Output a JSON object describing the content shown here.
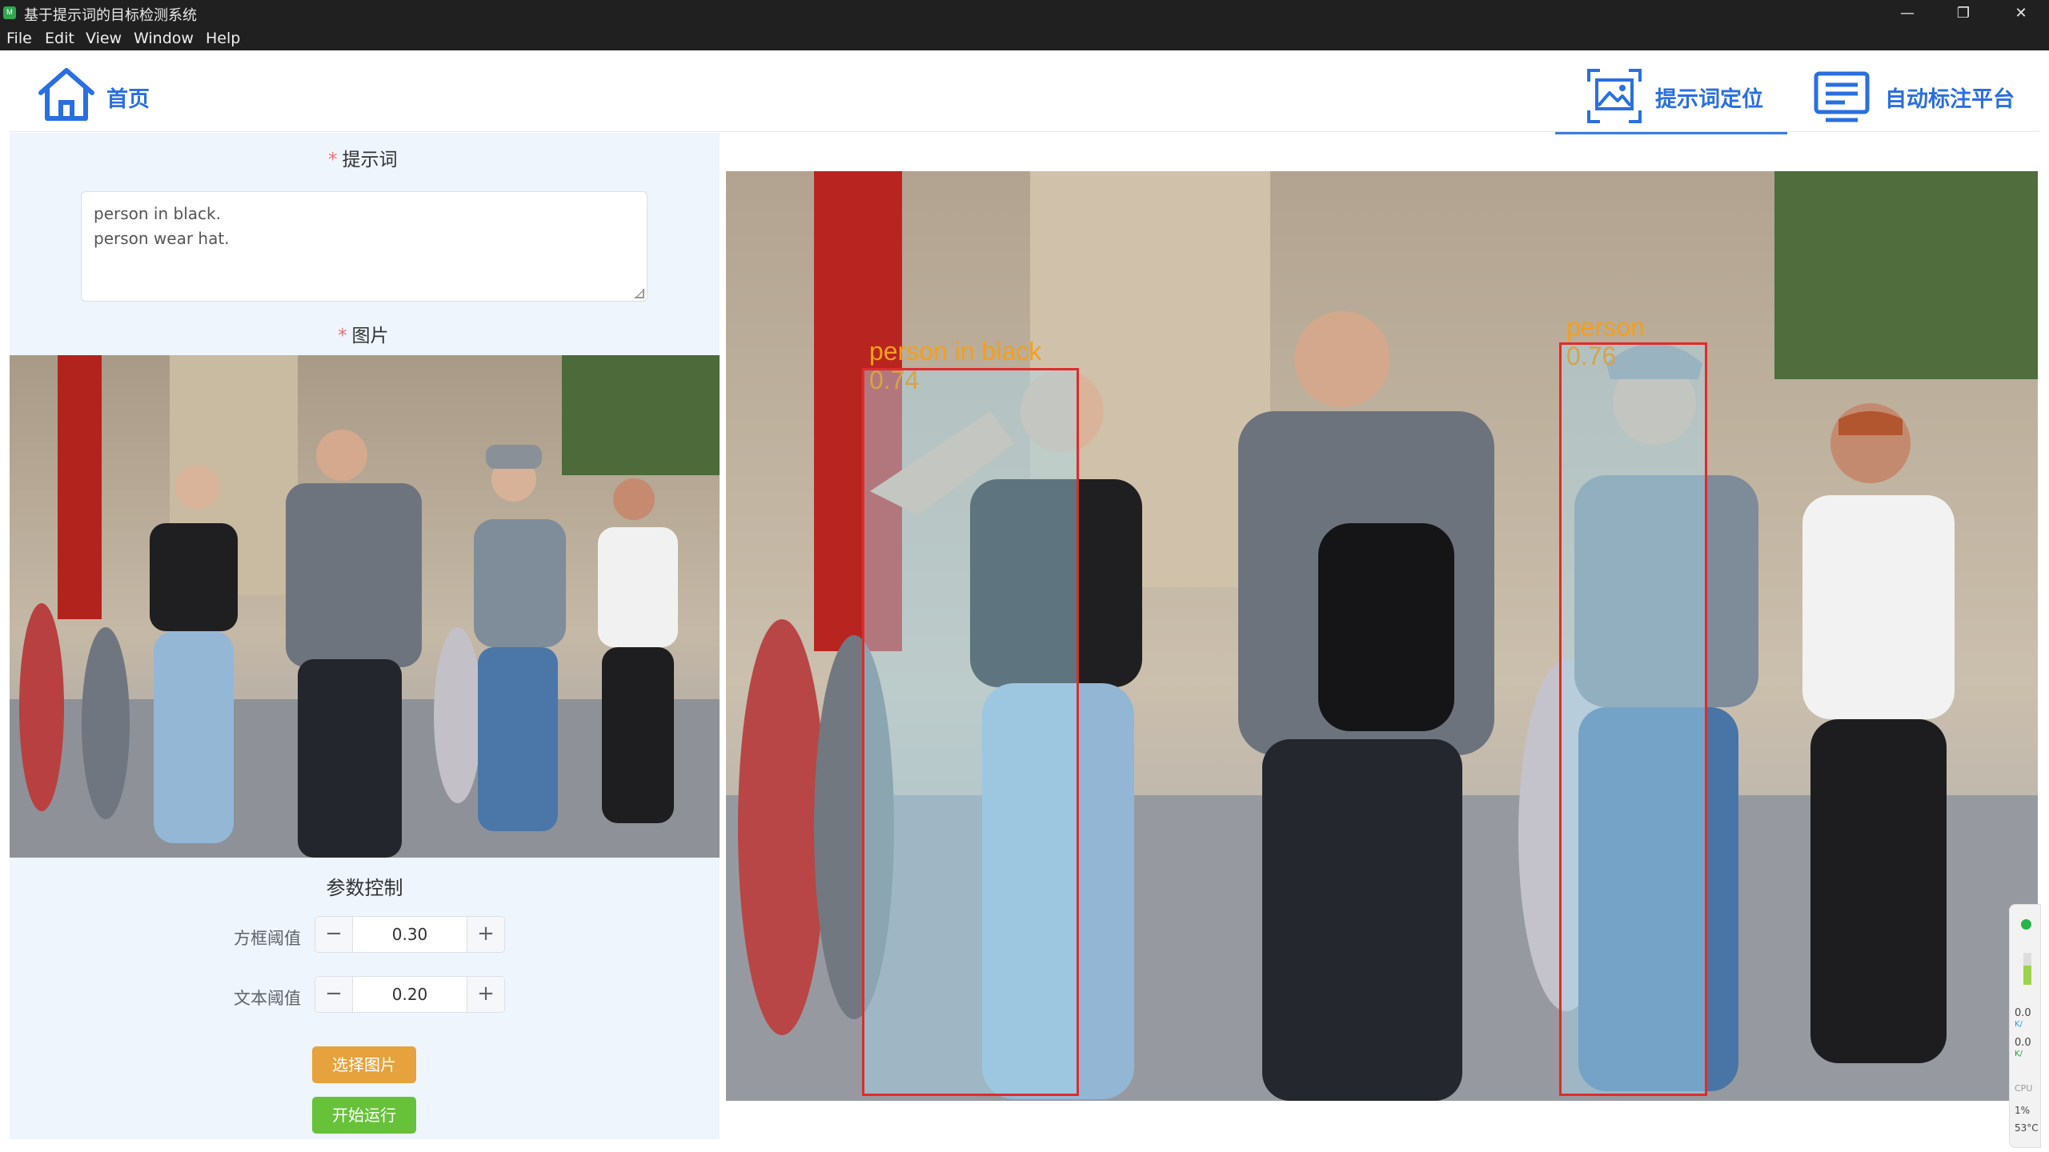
{
  "window": {
    "title": "基于提示词的目标检测系统",
    "controls": [
      "—",
      "❐",
      "✕"
    ]
  },
  "menu": [
    "File",
    "Edit",
    "View",
    "Window",
    "Help"
  ],
  "nav": {
    "home_label": "首页",
    "tabs": [
      {
        "label": "提示词定位",
        "icon": "image-frame-icon",
        "active": true
      },
      {
        "label": "自动标注平台",
        "icon": "list-monitor-icon",
        "active": false
      }
    ]
  },
  "form": {
    "prompt_label": "提示词",
    "prompt_lines": [
      "person in black.",
      "person wear hat."
    ],
    "image_label": "图片",
    "param_title": "参数控制",
    "box_threshold_label": "方框阈值",
    "box_threshold_value": "0.30",
    "text_threshold_label": "文本阈值",
    "text_threshold_value": "0.20",
    "stepper_minus": "−",
    "stepper_plus": "+",
    "select_button": "选择图片",
    "run_button": "开始运行"
  },
  "detections": [
    {
      "label": "person in black",
      "score": "0.74"
    },
    {
      "label": "person",
      "score": "0.76"
    }
  ],
  "monitor": {
    "net_up": "0.0",
    "net_up_unit": "K/",
    "net_down": "0.0",
    "net_down_unit": "K/",
    "cpu_label": "CPU",
    "cpu_value": "1%",
    "temp": "53°C"
  },
  "colors": {
    "accent_blue": "#2a6fe0",
    "box_red": "#e02b2b",
    "label_orange": "#f3a01b",
    "btn_orange": "#e6a23c",
    "btn_green": "#67c23a",
    "panel_bg": "#eef5fd"
  }
}
